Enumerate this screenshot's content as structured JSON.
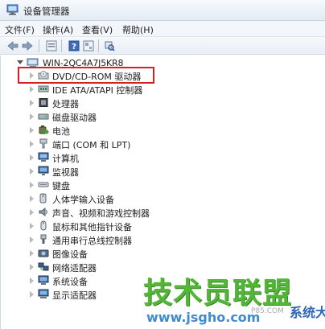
{
  "window": {
    "title": "设备管理器"
  },
  "menu": {
    "items": [
      "文件(F)",
      "操作(A)",
      "查看(V)",
      "帮助(H)"
    ]
  },
  "toolbar": {
    "buttons": [
      "back-icon",
      "forward-icon",
      "properties-icon",
      "help-icon",
      "show-hidden-icon",
      "scan-hardware-icon"
    ]
  },
  "tree": {
    "root": "WIN-2QC4A7J5KR8",
    "items": [
      {
        "label": "DVD/CD-ROM 驱动器",
        "icon": "dvd-drive-icon"
      },
      {
        "label": "IDE ATA/ATAPI 控制器",
        "icon": "ide-controller-icon"
      },
      {
        "label": "处理器",
        "icon": "processor-icon"
      },
      {
        "label": "磁盘驱动器",
        "icon": "disk-drive-icon"
      },
      {
        "label": "电池",
        "icon": "battery-icon"
      },
      {
        "label": "端口 (COM 和 LPT)",
        "icon": "port-icon"
      },
      {
        "label": "计算机",
        "icon": "computer-icon"
      },
      {
        "label": "监视器",
        "icon": "monitor-icon"
      },
      {
        "label": "键盘",
        "icon": "keyboard-icon"
      },
      {
        "label": "人体学输入设备",
        "icon": "hid-icon"
      },
      {
        "label": "声音、视频和游戏控制器",
        "icon": "sound-icon"
      },
      {
        "label": "鼠标和其他指针设备",
        "icon": "mouse-icon"
      },
      {
        "label": "通用串行总线控制器",
        "icon": "usb-icon"
      },
      {
        "label": "图像设备",
        "icon": "camera-icon"
      },
      {
        "label": "网络适配器",
        "icon": "network-icon"
      },
      {
        "label": "系统设备",
        "icon": "system-device-icon"
      },
      {
        "label": "显示适配器",
        "icon": "display-adapter-icon"
      }
    ]
  },
  "watermark": {
    "main": "技术员联盟",
    "url": "www.jsgho.com",
    "partial": "P85.COM",
    "right": "系统大全"
  },
  "colors": {
    "highlight": "#d42020",
    "watermark_green": "#49b32c",
    "watermark_blue": "#3f8bd0"
  }
}
